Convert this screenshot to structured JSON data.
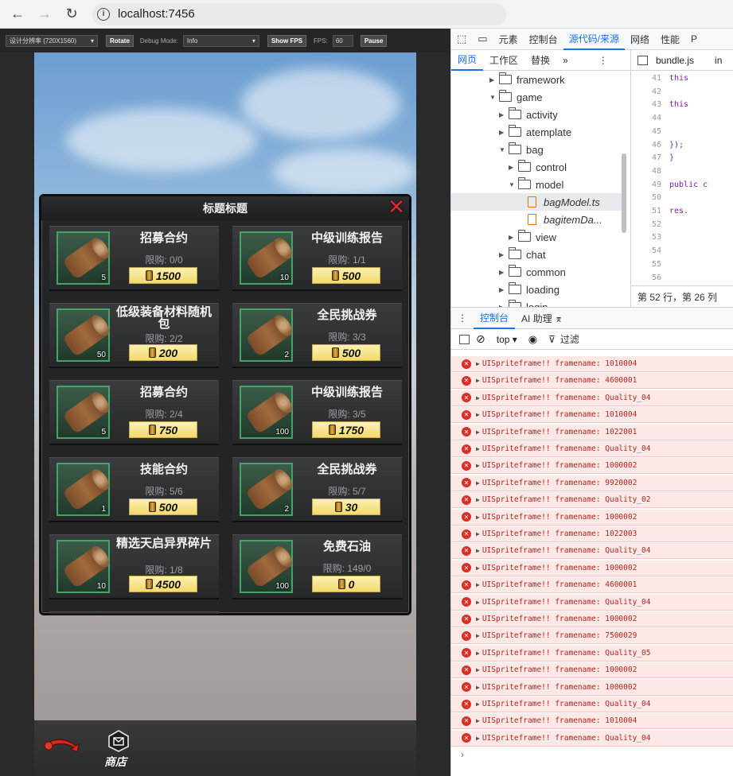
{
  "browser": {
    "url": "localhost:7456",
    "back": "←",
    "forward": "→",
    "reload": "↻"
  },
  "toolbar": {
    "resolution": "设计分辨率 (720X1560)",
    "rotate": "Rotate",
    "debug_label": "Debug Mode:",
    "debug_value": "Info",
    "show_fps": "Show FPS",
    "fps_label": "FPS:",
    "fps_value": "60",
    "pause": "Pause"
  },
  "panel": {
    "title": "标题标题",
    "close": "✕",
    "items": [
      {
        "name": "招募合约",
        "limit": "限购: 0/0",
        "price": "1500",
        "count": "5"
      },
      {
        "name": "中级训练报告",
        "limit": "限购: 1/1",
        "price": "500",
        "count": "10"
      },
      {
        "name": "低级装备材料随机包",
        "limit": "限购: 2/2",
        "price": "200",
        "count": "50"
      },
      {
        "name": "全民挑战券",
        "limit": "限购: 3/3",
        "price": "500",
        "count": "2"
      },
      {
        "name": "招募合约",
        "limit": "限购: 2/4",
        "price": "750",
        "count": "5"
      },
      {
        "name": "中级训练报告",
        "limit": "限购: 3/5",
        "price": "1750",
        "count": "100"
      },
      {
        "name": "技能合约",
        "limit": "限购: 5/6",
        "price": "500",
        "count": "1"
      },
      {
        "name": "全民挑战券",
        "limit": "限购: 5/7",
        "price": "30",
        "count": "2"
      },
      {
        "name": "精选天启异界碎片",
        "limit": "限购: 1/8",
        "price": "4500",
        "count": "10"
      },
      {
        "name": "免费石油",
        "limit": "限购: 149/0",
        "price": "0",
        "count": "100"
      }
    ]
  },
  "bottom": {
    "shop_label": "商店"
  },
  "devtools": {
    "tabs": [
      "元素",
      "控制台",
      "源代码/来源",
      "网络",
      "性能",
      "P"
    ],
    "active_tab": "源代码/来源",
    "sub_tabs": [
      "网页",
      "工作区",
      "替换",
      "»"
    ],
    "file_tab": "bundle.js",
    "file_tab2": "in",
    "tree": [
      {
        "label": "framework",
        "depth": 0,
        "type": "folder",
        "open": false
      },
      {
        "label": "game",
        "depth": 0,
        "type": "folder",
        "open": true
      },
      {
        "label": "activity",
        "depth": 1,
        "type": "folder",
        "open": false
      },
      {
        "label": "atemplate",
        "depth": 1,
        "type": "folder",
        "open": false
      },
      {
        "label": "bag",
        "depth": 1,
        "type": "folder",
        "open": true
      },
      {
        "label": "control",
        "depth": 2,
        "type": "folder",
        "open": false
      },
      {
        "label": "model",
        "depth": 2,
        "type": "folder",
        "open": true
      },
      {
        "label": "bagModel.ts",
        "depth": 3,
        "type": "file"
      },
      {
        "label": "bagitemDa...",
        "depth": 3,
        "type": "file"
      },
      {
        "label": "view",
        "depth": 2,
        "type": "folder",
        "open": false
      },
      {
        "label": "chat",
        "depth": 1,
        "type": "folder",
        "open": false
      },
      {
        "label": "common",
        "depth": 1,
        "type": "folder",
        "open": false
      },
      {
        "label": "loading",
        "depth": 1,
        "type": "folder",
        "open": false
      },
      {
        "label": "login",
        "depth": 1,
        "type": "folder",
        "open": false
      }
    ],
    "code_lines": [
      {
        "n": "41",
        "t": "    this"
      },
      {
        "n": "42",
        "t": ""
      },
      {
        "n": "43",
        "t": "    this"
      },
      {
        "n": "44",
        "t": ""
      },
      {
        "n": "45",
        "t": ""
      },
      {
        "n": "46",
        "t": "   });"
      },
      {
        "n": "47",
        "t": "}"
      },
      {
        "n": "48",
        "t": ""
      },
      {
        "n": "49",
        "t": "public c"
      },
      {
        "n": "50",
        "t": ""
      },
      {
        "n": "51",
        "t": "   res."
      },
      {
        "n": "52",
        "t": ""
      },
      {
        "n": "53",
        "t": ""
      },
      {
        "n": "54",
        "t": ""
      },
      {
        "n": "55",
        "t": ""
      },
      {
        "n": "56",
        "t": ""
      }
    ],
    "status": "第 52 行，第 26 列",
    "console_tabs": [
      "控制台",
      "AI 助理 ⌆"
    ],
    "context": "top ▾",
    "filter": "过滤",
    "messages": [
      "UISpriteframe!! framename: 1010004",
      "UISpriteframe!! framename: 4600001",
      "UISpriteframe!! framename: Quality_04",
      "UISpriteframe!! framename: 1010004",
      "UISpriteframe!! framename: 1022001",
      "UISpriteframe!! framename: Quality_04",
      "UISpriteframe!! framename: 1000002",
      "UISpriteframe!! framename: 9920002",
      "UISpriteframe!! framename: Quality_02",
      "UISpriteframe!! framename: 1000002",
      "UISpriteframe!! framename: 1022003",
      "UISpriteframe!! framename: Quality_04",
      "UISpriteframe!! framename: 1000002",
      "UISpriteframe!! framename: 4600001",
      "UISpriteframe!! framename: Quality_04",
      "UISpriteframe!! framename: 1000002",
      "UISpriteframe!! framename: 7500029",
      "UISpriteframe!! framename: Quality_05",
      "UISpriteframe!! framename: 1000002",
      "UISpriteframe!! framename: 1000002",
      "UISpriteframe!! framename: Quality_04",
      "UISpriteframe!! framename: 1010004",
      "UISpriteframe!! framename: Quality_04"
    ],
    "prompt": "›"
  }
}
